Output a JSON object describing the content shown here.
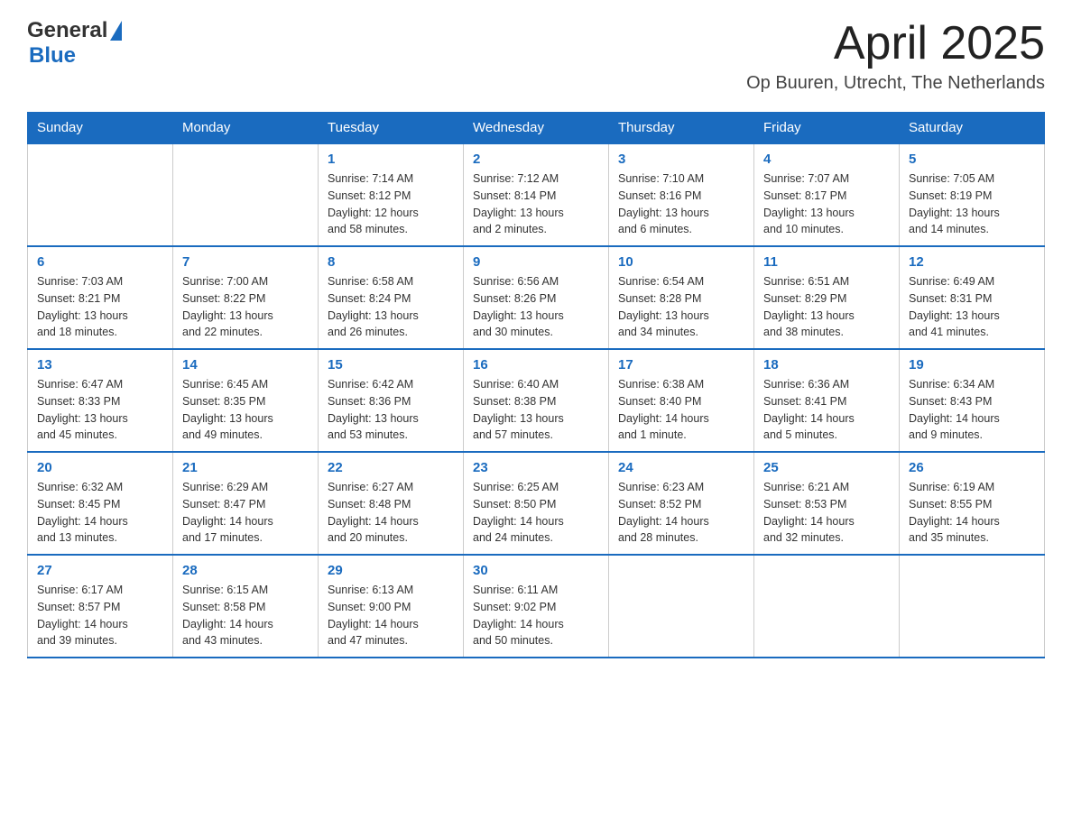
{
  "header": {
    "logo": {
      "general": "General",
      "blue": "Blue"
    },
    "title": "April 2025",
    "location": "Op Buuren, Utrecht, The Netherlands"
  },
  "calendar": {
    "days_of_week": [
      "Sunday",
      "Monday",
      "Tuesday",
      "Wednesday",
      "Thursday",
      "Friday",
      "Saturday"
    ],
    "weeks": [
      [
        {
          "day": "",
          "info": ""
        },
        {
          "day": "",
          "info": ""
        },
        {
          "day": "1",
          "info": "Sunrise: 7:14 AM\nSunset: 8:12 PM\nDaylight: 12 hours\nand 58 minutes."
        },
        {
          "day": "2",
          "info": "Sunrise: 7:12 AM\nSunset: 8:14 PM\nDaylight: 13 hours\nand 2 minutes."
        },
        {
          "day": "3",
          "info": "Sunrise: 7:10 AM\nSunset: 8:16 PM\nDaylight: 13 hours\nand 6 minutes."
        },
        {
          "day": "4",
          "info": "Sunrise: 7:07 AM\nSunset: 8:17 PM\nDaylight: 13 hours\nand 10 minutes."
        },
        {
          "day": "5",
          "info": "Sunrise: 7:05 AM\nSunset: 8:19 PM\nDaylight: 13 hours\nand 14 minutes."
        }
      ],
      [
        {
          "day": "6",
          "info": "Sunrise: 7:03 AM\nSunset: 8:21 PM\nDaylight: 13 hours\nand 18 minutes."
        },
        {
          "day": "7",
          "info": "Sunrise: 7:00 AM\nSunset: 8:22 PM\nDaylight: 13 hours\nand 22 minutes."
        },
        {
          "day": "8",
          "info": "Sunrise: 6:58 AM\nSunset: 8:24 PM\nDaylight: 13 hours\nand 26 minutes."
        },
        {
          "day": "9",
          "info": "Sunrise: 6:56 AM\nSunset: 8:26 PM\nDaylight: 13 hours\nand 30 minutes."
        },
        {
          "day": "10",
          "info": "Sunrise: 6:54 AM\nSunset: 8:28 PM\nDaylight: 13 hours\nand 34 minutes."
        },
        {
          "day": "11",
          "info": "Sunrise: 6:51 AM\nSunset: 8:29 PM\nDaylight: 13 hours\nand 38 minutes."
        },
        {
          "day": "12",
          "info": "Sunrise: 6:49 AM\nSunset: 8:31 PM\nDaylight: 13 hours\nand 41 minutes."
        }
      ],
      [
        {
          "day": "13",
          "info": "Sunrise: 6:47 AM\nSunset: 8:33 PM\nDaylight: 13 hours\nand 45 minutes."
        },
        {
          "day": "14",
          "info": "Sunrise: 6:45 AM\nSunset: 8:35 PM\nDaylight: 13 hours\nand 49 minutes."
        },
        {
          "day": "15",
          "info": "Sunrise: 6:42 AM\nSunset: 8:36 PM\nDaylight: 13 hours\nand 53 minutes."
        },
        {
          "day": "16",
          "info": "Sunrise: 6:40 AM\nSunset: 8:38 PM\nDaylight: 13 hours\nand 57 minutes."
        },
        {
          "day": "17",
          "info": "Sunrise: 6:38 AM\nSunset: 8:40 PM\nDaylight: 14 hours\nand 1 minute."
        },
        {
          "day": "18",
          "info": "Sunrise: 6:36 AM\nSunset: 8:41 PM\nDaylight: 14 hours\nand 5 minutes."
        },
        {
          "day": "19",
          "info": "Sunrise: 6:34 AM\nSunset: 8:43 PM\nDaylight: 14 hours\nand 9 minutes."
        }
      ],
      [
        {
          "day": "20",
          "info": "Sunrise: 6:32 AM\nSunset: 8:45 PM\nDaylight: 14 hours\nand 13 minutes."
        },
        {
          "day": "21",
          "info": "Sunrise: 6:29 AM\nSunset: 8:47 PM\nDaylight: 14 hours\nand 17 minutes."
        },
        {
          "day": "22",
          "info": "Sunrise: 6:27 AM\nSunset: 8:48 PM\nDaylight: 14 hours\nand 20 minutes."
        },
        {
          "day": "23",
          "info": "Sunrise: 6:25 AM\nSunset: 8:50 PM\nDaylight: 14 hours\nand 24 minutes."
        },
        {
          "day": "24",
          "info": "Sunrise: 6:23 AM\nSunset: 8:52 PM\nDaylight: 14 hours\nand 28 minutes."
        },
        {
          "day": "25",
          "info": "Sunrise: 6:21 AM\nSunset: 8:53 PM\nDaylight: 14 hours\nand 32 minutes."
        },
        {
          "day": "26",
          "info": "Sunrise: 6:19 AM\nSunset: 8:55 PM\nDaylight: 14 hours\nand 35 minutes."
        }
      ],
      [
        {
          "day": "27",
          "info": "Sunrise: 6:17 AM\nSunset: 8:57 PM\nDaylight: 14 hours\nand 39 minutes."
        },
        {
          "day": "28",
          "info": "Sunrise: 6:15 AM\nSunset: 8:58 PM\nDaylight: 14 hours\nand 43 minutes."
        },
        {
          "day": "29",
          "info": "Sunrise: 6:13 AM\nSunset: 9:00 PM\nDaylight: 14 hours\nand 47 minutes."
        },
        {
          "day": "30",
          "info": "Sunrise: 6:11 AM\nSunset: 9:02 PM\nDaylight: 14 hours\nand 50 minutes."
        },
        {
          "day": "",
          "info": ""
        },
        {
          "day": "",
          "info": ""
        },
        {
          "day": "",
          "info": ""
        }
      ]
    ]
  }
}
